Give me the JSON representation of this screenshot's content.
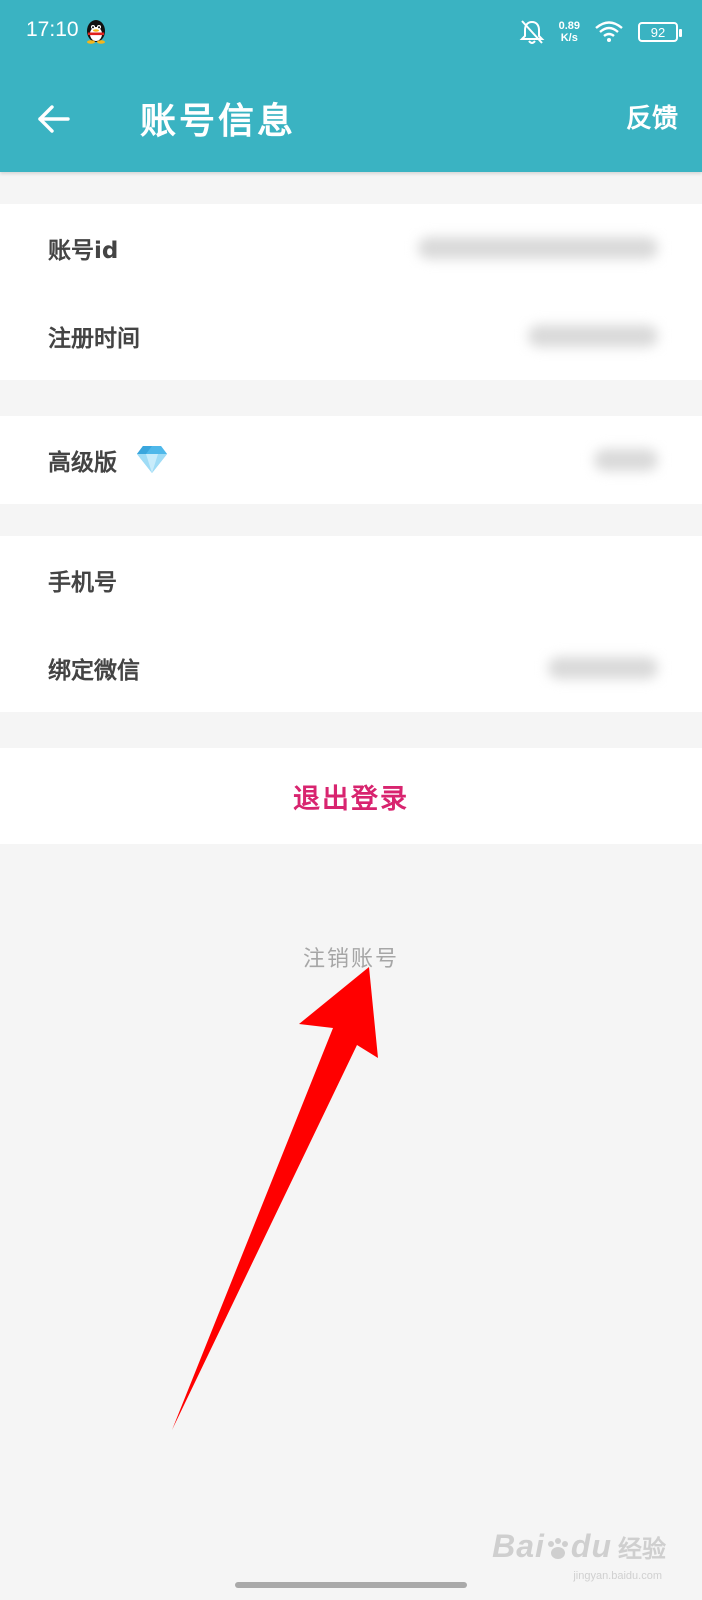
{
  "status_bar": {
    "time": "17:10",
    "net_speed_value": "0.89",
    "net_speed_unit": "K/s",
    "battery": "92",
    "icons": [
      "qq-penguin-icon",
      "bell-muted-icon",
      "wifi-icon",
      "battery-icon"
    ]
  },
  "header": {
    "back_icon": "arrow-left-icon",
    "title": "账号信息",
    "feedback_label": "反馈",
    "background_color": "#3ab3c2"
  },
  "sections": [
    {
      "rows": [
        {
          "label": "账号id"
        },
        {
          "label": "注册时间"
        }
      ]
    },
    {
      "rows": [
        {
          "label": "高级版",
          "icon": "diamond-icon"
        }
      ]
    },
    {
      "rows": [
        {
          "label": "手机号"
        },
        {
          "label": "绑定微信"
        }
      ]
    }
  ],
  "logout": {
    "label": "退出登录",
    "color": "#d8246f"
  },
  "cancel_account": {
    "label": "注销账号"
  },
  "annotation": {
    "type": "red-arrow-icon",
    "color": "#ff0000"
  },
  "watermark": {
    "brand": "Bai",
    "brand_suffix": "du",
    "cn": "经验",
    "url": "jingyan.baidu.com"
  }
}
